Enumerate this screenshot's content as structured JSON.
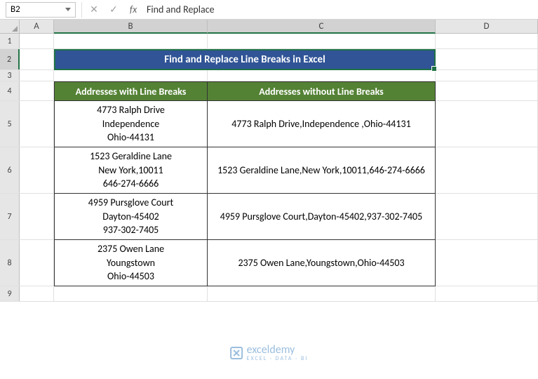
{
  "formula_bar": {
    "name_box": "B2",
    "formula": "Find and Replace"
  },
  "columns": [
    "A",
    "B",
    "C",
    "D"
  ],
  "row_numbers": [
    1,
    2,
    3,
    4,
    5,
    6,
    7,
    8,
    9
  ],
  "selected_cell": "B2",
  "title": "Find and Replace Line Breaks in Excel",
  "table": {
    "headers": {
      "col_b": "Addresses with Line Breaks",
      "col_c": "Addresses without Line Breaks"
    },
    "rows": [
      {
        "with_breaks": "4773 Ralph Drive\nIndependence\nOhio-44131",
        "without_breaks": "4773 Ralph Drive,Independence ,Ohio-44131"
      },
      {
        "with_breaks": "1523 Geraldine Lane\nNew York,10011\n646-274-6666",
        "without_breaks": "1523 Geraldine Lane,New York,10011,646-274-6666"
      },
      {
        "with_breaks": "4959 Pursglove Court\nDayton-45402\n937-302-7405",
        "without_breaks": "4959 Pursglove Court,Dayton-45402,937-302-7405"
      },
      {
        "with_breaks": "2375 Owen Lane\nYoungstown\nOhio-44503",
        "without_breaks": "2375 Owen Lane,Youngstown,Ohio-44503"
      }
    ]
  },
  "watermark": {
    "brand": "exceldemy",
    "tagline": "EXCEL · DATA · BI"
  },
  "colors": {
    "title_bg": "#305496",
    "header_bg": "#548235",
    "selection": "#1f7246"
  }
}
